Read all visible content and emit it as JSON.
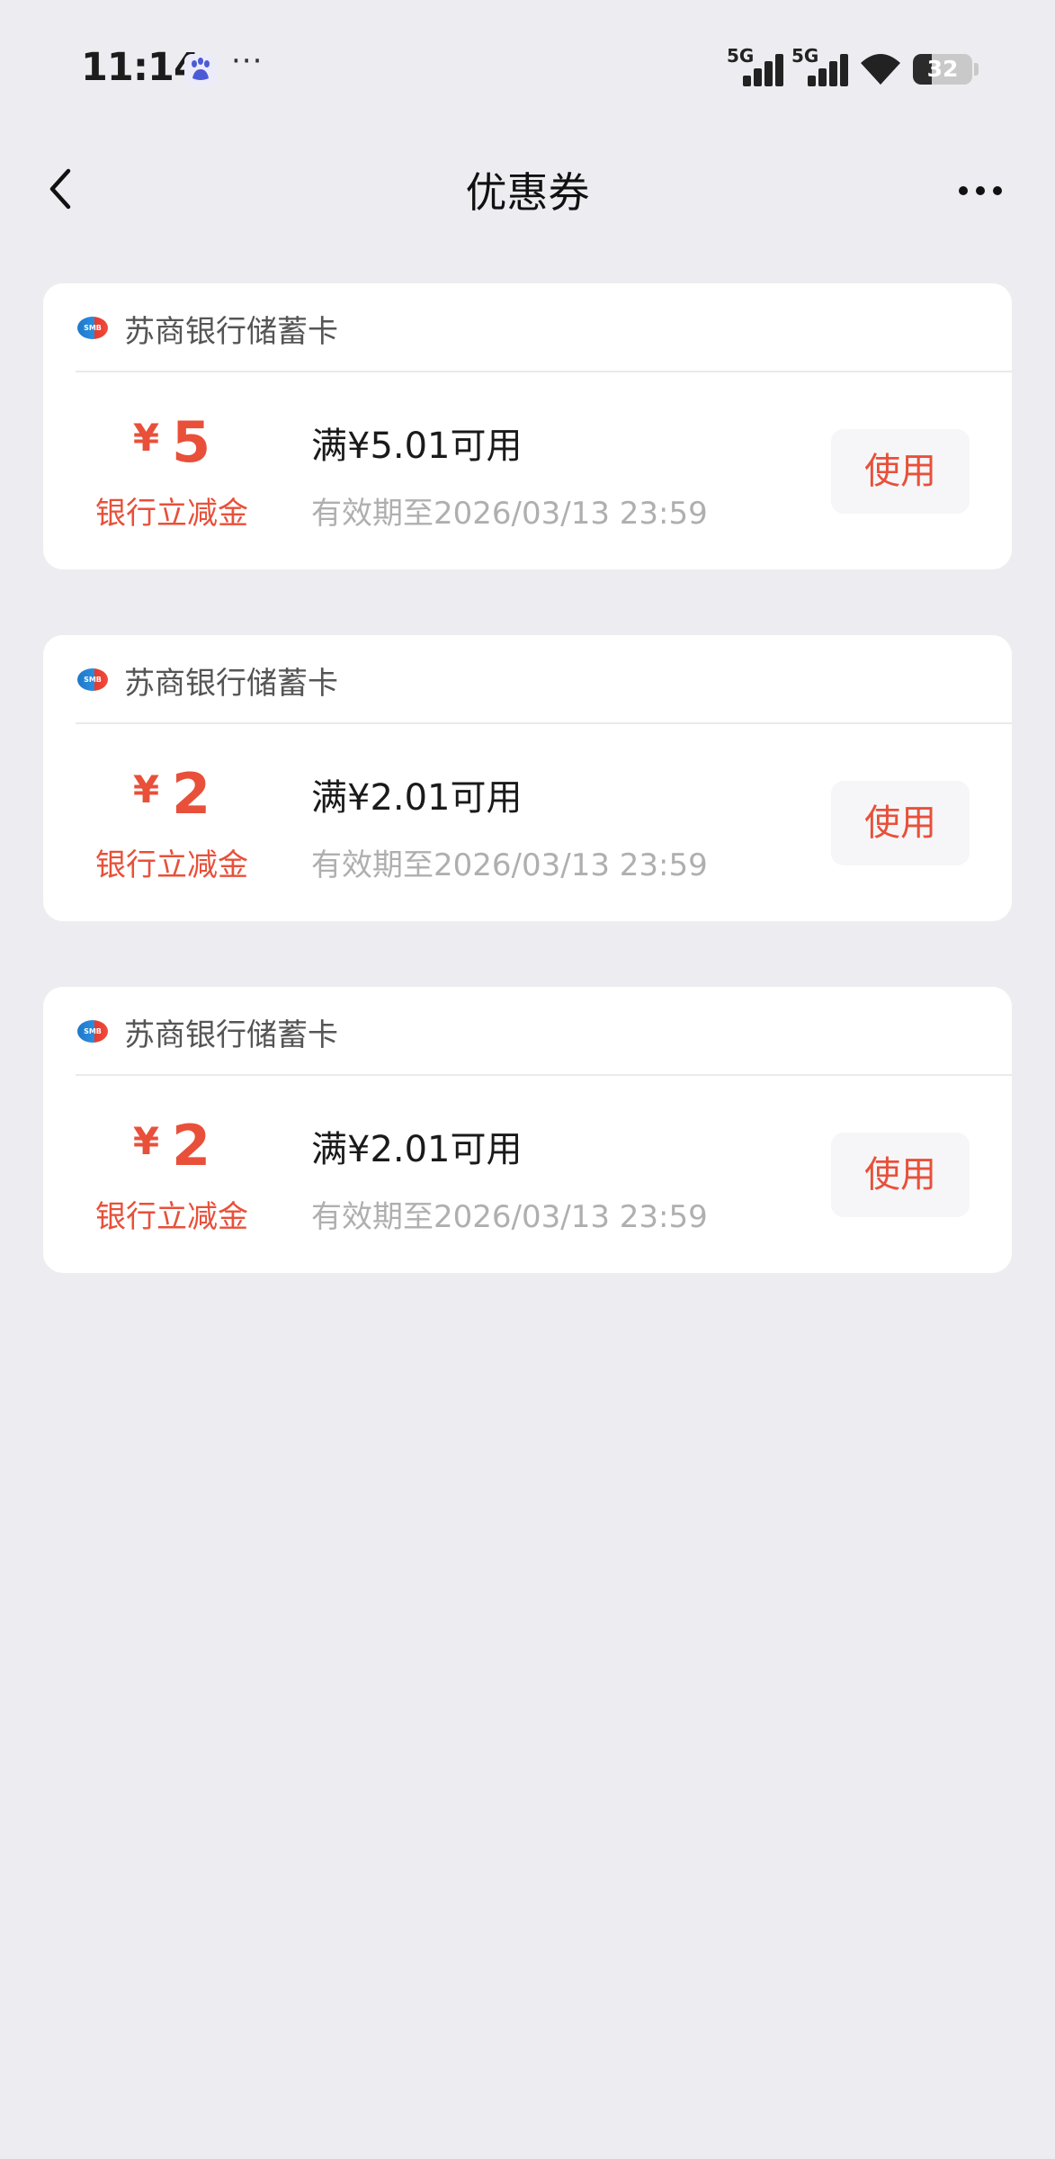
{
  "status_bar": {
    "time": "11:14",
    "notification_icons": [
      "baidu-paw-icon",
      "more-dots-icon"
    ],
    "more_indicator": "···",
    "signal_label": "5G",
    "battery_level": "32",
    "battery_fraction": 0.32
  },
  "nav": {
    "title": "优惠券",
    "back_icon": "chevron-left-icon",
    "more_icon": "more-horizontal-icon"
  },
  "coupons": [
    {
      "bank": "苏商银行储蓄卡",
      "bank_logo_text": "SMB",
      "currency": "¥",
      "amount": "5",
      "amount_label": "银行立减金",
      "condition": "满¥5.01可用",
      "expiry": "有效期至2026/03/13 23:59",
      "action": "使用"
    },
    {
      "bank": "苏商银行储蓄卡",
      "bank_logo_text": "SMB",
      "currency": "¥",
      "amount": "2",
      "amount_label": "银行立减金",
      "condition": "满¥2.01可用",
      "expiry": "有效期至2026/03/13 23:59",
      "action": "使用"
    },
    {
      "bank": "苏商银行储蓄卡",
      "bank_logo_text": "SMB",
      "currency": "¥",
      "amount": "2",
      "amount_label": "银行立减金",
      "condition": "满¥2.01可用",
      "expiry": "有效期至2026/03/13 23:59",
      "action": "使用"
    }
  ],
  "colors": {
    "accent": "#E8503A",
    "page_background": "#EDEDF1",
    "card_background": "#FFFFFF",
    "muted_text": "#AFAFAF"
  }
}
